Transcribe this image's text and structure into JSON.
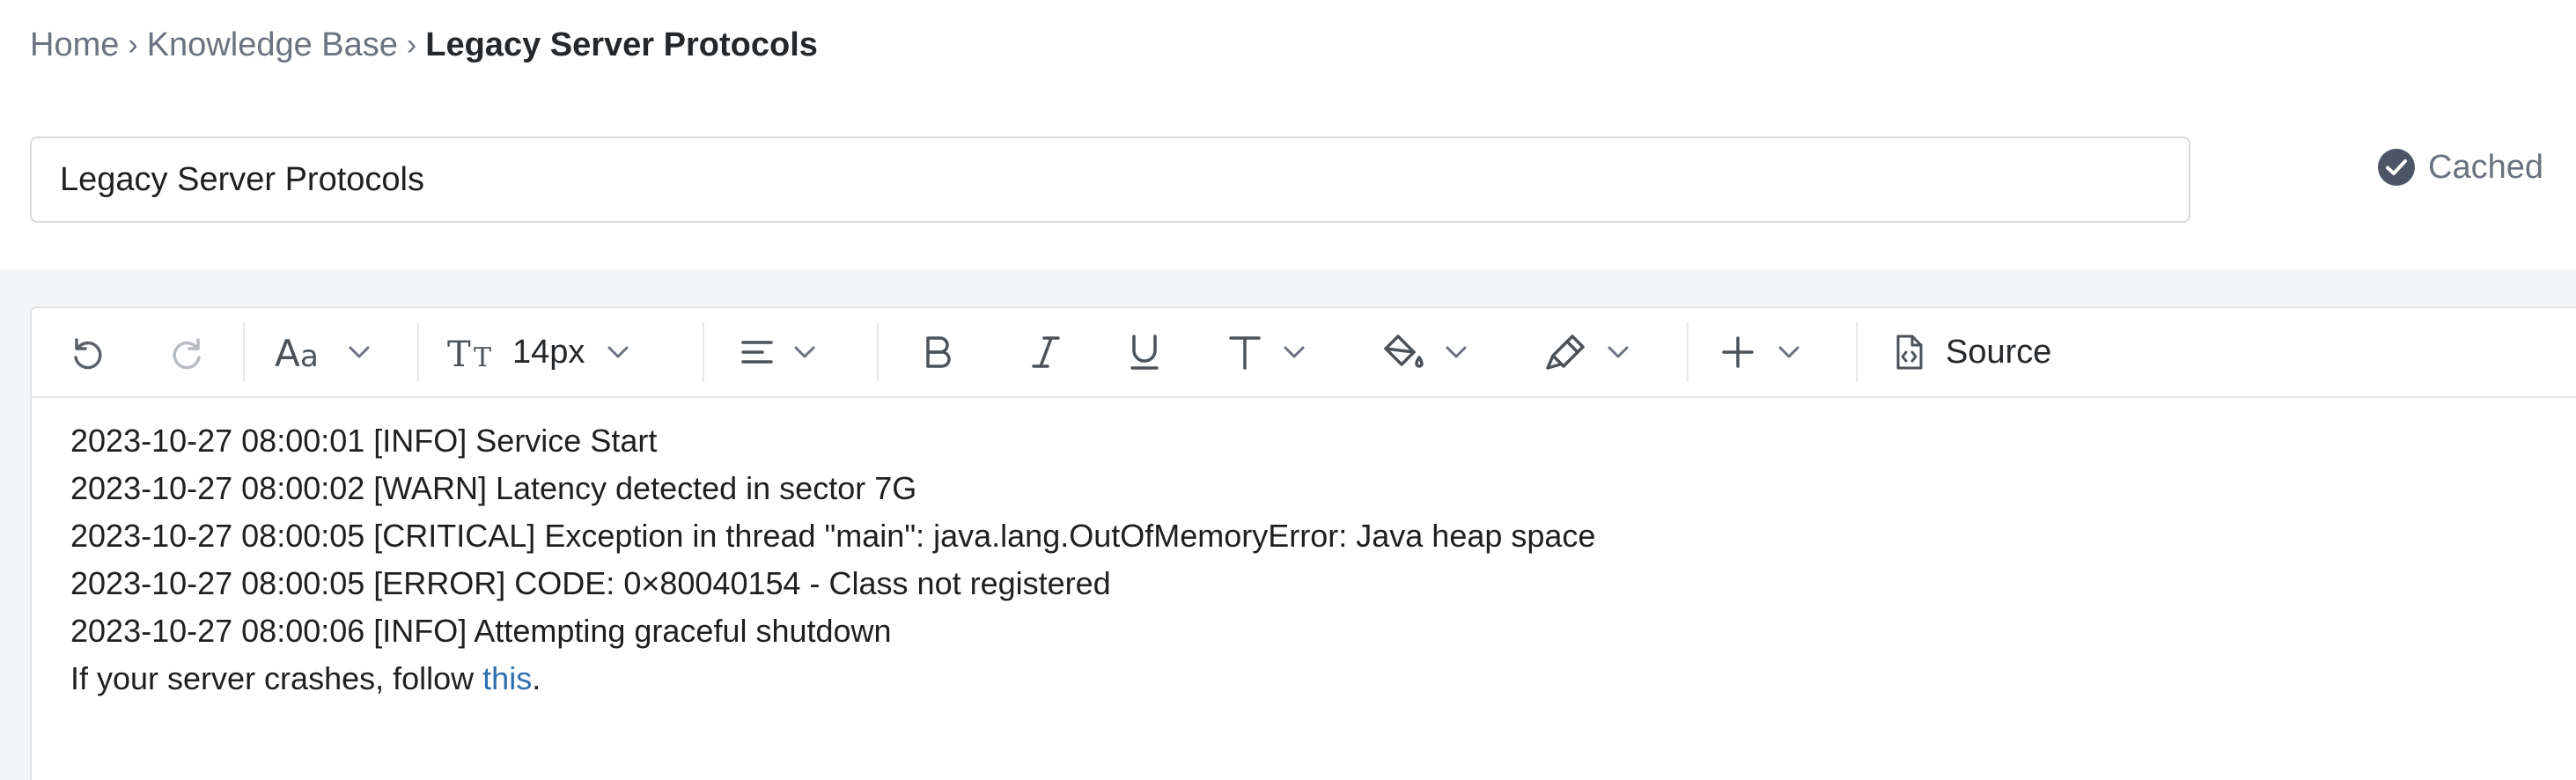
{
  "breadcrumb": {
    "items": [
      "Home",
      "Knowledge Base"
    ],
    "current": "Legacy Server Protocols",
    "separator": "›"
  },
  "title_field": {
    "value": "Legacy Server Protocols"
  },
  "status": {
    "label": "Cached",
    "icon": "check-circle-icon"
  },
  "toolbar": {
    "undo_icon": "undo-icon",
    "redo_icon": "redo-icon",
    "font_family_icon": "font-family-icon",
    "font_size_value": "14px",
    "align_icon": "align-left-icon",
    "bold_icon": "bold-icon",
    "italic_icon": "italic-icon",
    "underline_icon": "underline-icon",
    "text_style_icon": "text-style-icon",
    "fill_icon": "fill-color-icon",
    "highlight_icon": "highlighter-icon",
    "insert_icon": "plus-icon",
    "source_label": "Source"
  },
  "content": {
    "lines": [
      "2023-10-27 08:00:01 [INFO] Service Start",
      "2023-10-27 08:00:02 [WARN] Latency detected in sector 7G",
      "2023-10-27 08:00:05 [CRITICAL] Exception in thread \"main\": java.lang.OutOfMemoryError: Java heap space",
      "2023-10-27 08:00:05 [ERROR] CODE: 0×80040154 - Class not registered",
      "2023-10-27 08:00:06 [INFO] Attempting graceful shutdown"
    ],
    "footer_prefix": "If your server crashes, follow ",
    "footer_link": "this",
    "footer_suffix": "."
  },
  "colors": {
    "link": "#2f6fb0",
    "muted": "#6b7280",
    "editor_band": "#f4f5f6"
  }
}
